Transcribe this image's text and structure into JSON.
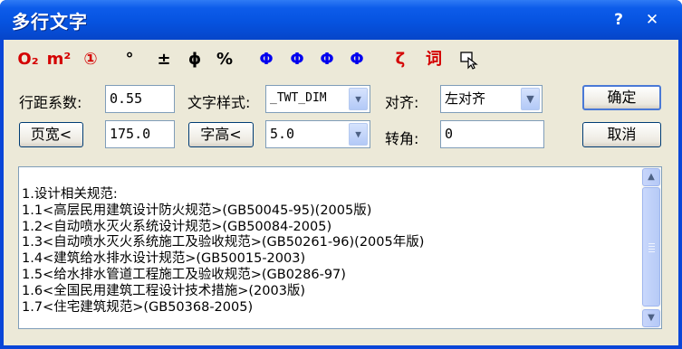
{
  "window": {
    "title": "多行文字",
    "help_label": "?",
    "close_label": "✕"
  },
  "toolbar": {
    "items": [
      {
        "label": "O₂",
        "name": "subscript-tool",
        "color": "#d40000"
      },
      {
        "label": "m²",
        "name": "superscript-tool",
        "color": "#d40000"
      },
      {
        "label": "①",
        "name": "circled-number-tool",
        "color": "#d40000"
      },
      {
        "label": "°",
        "name": "degree-symbol-tool",
        "color": "#000000"
      },
      {
        "label": "±",
        "name": "plus-minus-tool",
        "color": "#000000"
      },
      {
        "label": "ϕ",
        "name": "diameter-tool",
        "color": "#000000"
      },
      {
        "label": "%",
        "name": "percent-tool",
        "color": "#000000"
      },
      {
        "label": "Φ",
        "name": "steel-grade-1-tool",
        "color": "#0000ee"
      },
      {
        "label": "Φ",
        "name": "steel-grade-2-tool",
        "color": "#0000ee"
      },
      {
        "label": "Φ",
        "name": "steel-grade-3-tool",
        "color": "#0000ee"
      },
      {
        "label": "Φ",
        "name": "steel-grade-4-tool",
        "color": "#0000ee"
      },
      {
        "label": "ζ",
        "name": "special-char-tool",
        "color": "#d40000"
      },
      {
        "label": "词",
        "name": "phrase-library-tool",
        "color": "#d40000"
      }
    ]
  },
  "form": {
    "line_spacing_label": "行距系数:",
    "line_spacing_value": "0.55",
    "text_style_label": "文字样式:",
    "text_style_value": "_TWT_DIM",
    "align_label": "对齐:",
    "align_value": "左对齐",
    "page_width_button": "页宽<",
    "page_width_value": "175.0",
    "char_height_button": "字高<",
    "char_height_value": "5.0",
    "rotation_label": "转角:",
    "rotation_value": "0",
    "ok_button": "确定",
    "cancel_button": "取消"
  },
  "content": {
    "lines": [
      "1.设计相关规范:",
      "1.1<高层民用建筑设计防火规范>(GB50045-95)(2005版)",
      "1.2<自动喷水灭火系统设计规范>(GB50084-2005)",
      "1.3<自动喷水灭火系统施工及验收规范>(GB50261-96)(2005年版)",
      "1.4<建筑给水排水设计规范>(GB50015-2003)",
      "1.5<给水排水管道工程施工及验收规范>(GB0286-97)",
      "1.6<全国民用建筑工程设计技术措施>(2003版)",
      "1.7<住宅建筑规范>(GB50368-2005)"
    ]
  },
  "colors": {
    "title_bar": "#0653e0",
    "client_bg": "#ece9d8",
    "red_tool": "#d40000",
    "blue_tool": "#0000ee"
  }
}
